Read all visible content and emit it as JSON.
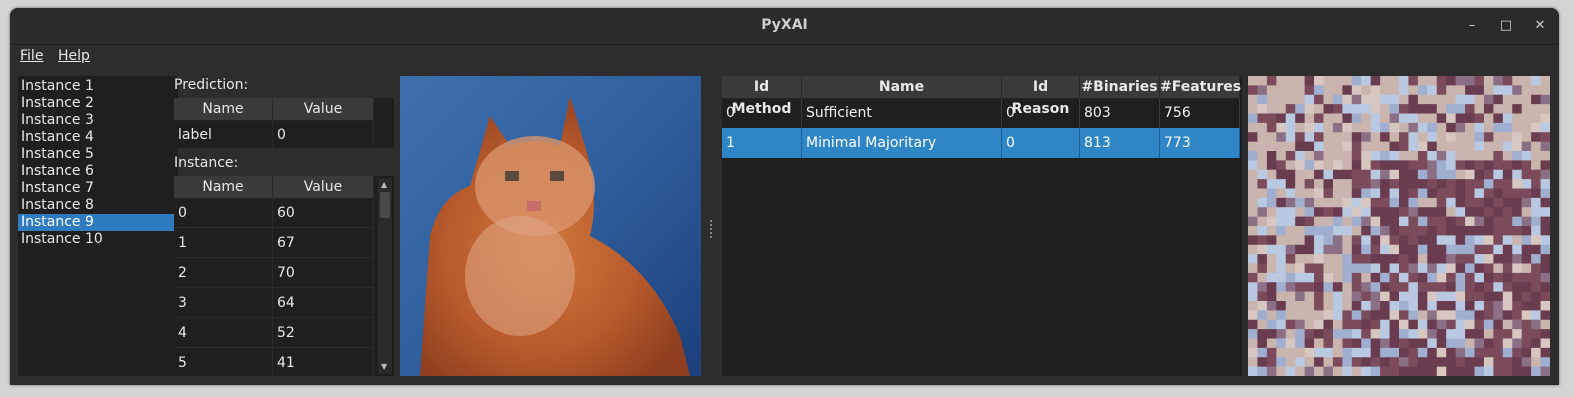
{
  "window": {
    "title": "PyXAI"
  },
  "menu": {
    "file": "File",
    "help": "Help"
  },
  "instances": {
    "items": [
      "Instance 1",
      "Instance 2",
      "Instance 3",
      "Instance 4",
      "Instance 5",
      "Instance 6",
      "Instance 7",
      "Instance 8",
      "Instance 9",
      "Instance 10"
    ],
    "selected_index": 8
  },
  "prediction": {
    "label": "Prediction:",
    "headers": [
      "Name",
      "Value"
    ],
    "rows": [
      [
        "label",
        "0"
      ]
    ]
  },
  "instance_table": {
    "label": "Instance:",
    "headers": [
      "Name",
      "Value"
    ],
    "rows": [
      [
        "0",
        "60"
      ],
      [
        "1",
        "67"
      ],
      [
        "2",
        "70"
      ],
      [
        "3",
        "64"
      ],
      [
        "4",
        "52"
      ],
      [
        "5",
        "41"
      ]
    ]
  },
  "explanations": {
    "headers": [
      "Id Method",
      "Name",
      "Id Reason",
      "#Binaries",
      "#Features"
    ],
    "rows": [
      [
        "0",
        "Sufficient",
        "0",
        "803",
        "756"
      ],
      [
        "1",
        "Minimal Majoritary",
        "0",
        "813",
        "773"
      ]
    ],
    "selected_index": 1
  },
  "colors": {
    "selection": "#2f7bbf",
    "window_bg": "#2d2d2d",
    "panel_bg": "#1f1f1f"
  }
}
